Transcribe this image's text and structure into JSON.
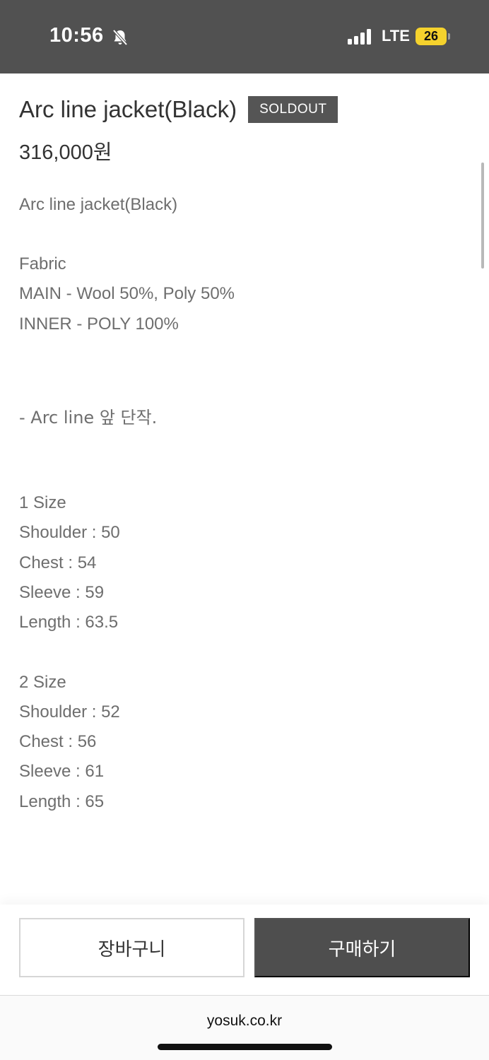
{
  "status_bar": {
    "time": "10:56",
    "network": "LTE",
    "battery": "26",
    "icons": [
      "bell-slash-icon",
      "signal-icon"
    ]
  },
  "product": {
    "title": "Arc line jacket(Black)",
    "badge": "SOLDOUT",
    "price": "316,000원",
    "description": {
      "name": "Arc line jacket(Black)",
      "fabric_heading": "Fabric",
      "fabric_main": "MAIN - Wool 50%, Poly 50%",
      "fabric_inner": "INNER - POLY 100%",
      "detail": "- Arc line 앞 단작.",
      "sizes": [
        {
          "heading": "1 Size",
          "shoulder": "Shoulder : 50",
          "chest": "Chest : 54",
          "sleeve": "Sleeve : 59",
          "length": "Length : 63.5"
        },
        {
          "heading": "2 Size",
          "shoulder": "Shoulder : 52",
          "chest": "Chest : 56",
          "sleeve": "Sleeve : 61",
          "length": "Length : 65"
        }
      ]
    }
  },
  "actions": {
    "cart_label": "장바구니",
    "buy_label": "구매하기"
  },
  "browser": {
    "url": "yosuk.co.kr"
  },
  "colors": {
    "status_bar_bg": "#515151",
    "badge_bg": "#555555",
    "buy_button_bg": "#4e4e4e",
    "battery": "#f5d22d"
  }
}
